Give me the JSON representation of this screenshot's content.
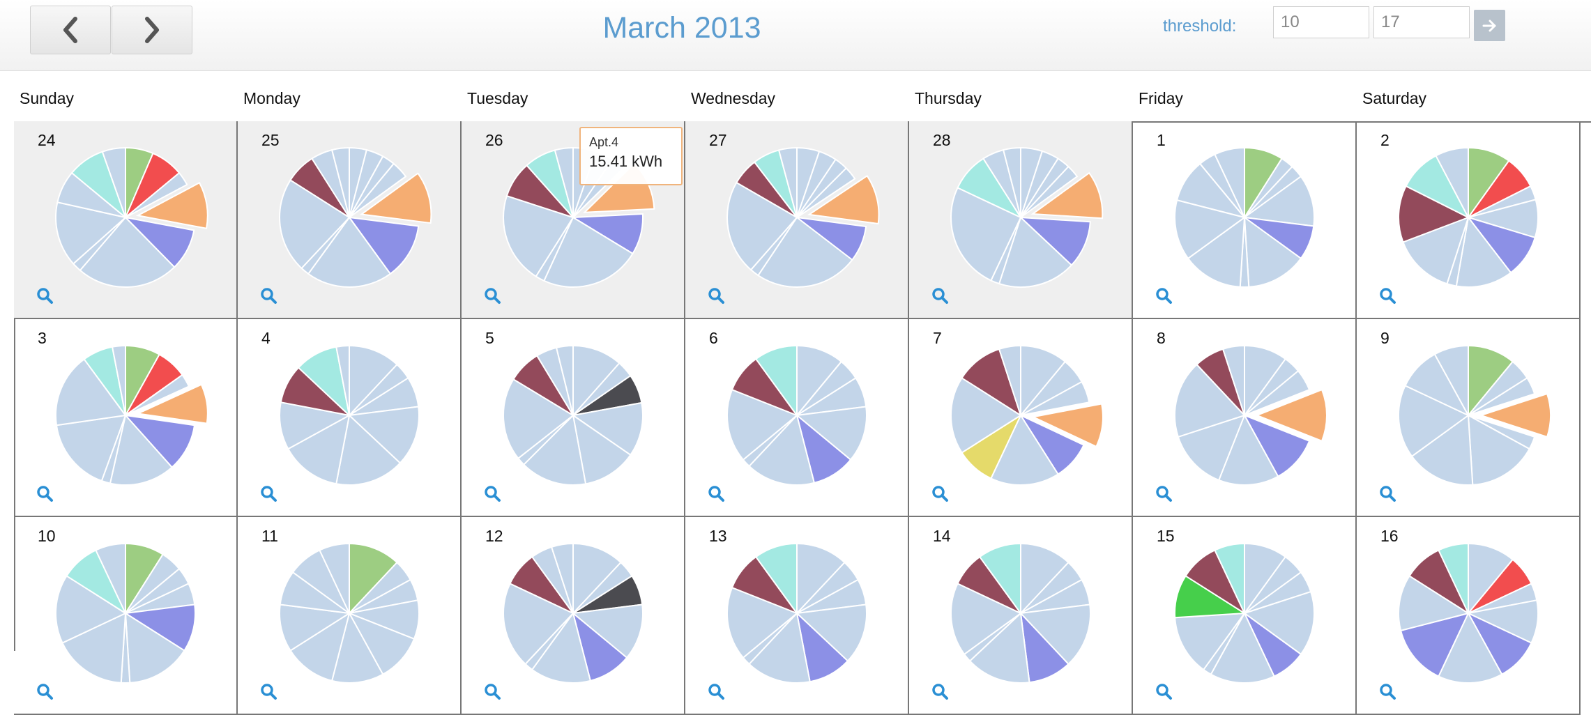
{
  "header": {
    "title": "March 2013",
    "prev_icon": "chevron-left-icon",
    "next_icon": "chevron-right-icon",
    "threshold_label": "threshold:",
    "threshold_low": "10",
    "threshold_high": "17",
    "go_icon": "arrow-right-icon"
  },
  "weekdays": [
    "Sunday",
    "Monday",
    "Tuesday",
    "Wednesday",
    "Thursday",
    "Friday",
    "Saturday"
  ],
  "colors": {
    "default": "#c3d5e9",
    "apt_green": "#9dcd82",
    "apt_red": "#f24d4e",
    "apt_orange": "#f5ad72",
    "apt_purple": "#8c90e6",
    "apt_maroon": "#934a5b",
    "apt_teal": "#a3e9e2",
    "apt_dark": "#4b4b50",
    "apt_yellow": "#e5da6a",
    "apt_brightgreen": "#46cf4b",
    "accent_blue": "#5b9ccf",
    "tooltip_border": "#f0b47c"
  },
  "tooltip": {
    "name": "Apt.4",
    "value": "15.41 kWh"
  },
  "weeks": [
    [
      {
        "day": "24",
        "other": true,
        "slices": [
          {
            "v": 6,
            "c": "apt_green"
          },
          {
            "v": 7,
            "c": "apt_red"
          },
          {
            "v": 3
          },
          {
            "v": 10,
            "c": "apt_orange",
            "x": true
          },
          {
            "v": 9,
            "c": "apt_purple"
          },
          {
            "v": 22
          },
          {
            "v": 2
          },
          {
            "v": 14
          },
          {
            "v": 7
          },
          {
            "v": 8,
            "c": "apt_teal"
          },
          {
            "v": 5
          }
        ]
      },
      {
        "day": "25",
        "other": true,
        "slices": [
          {
            "v": 4
          },
          {
            "v": 4
          },
          {
            "v": 3
          },
          {
            "v": 4
          },
          {
            "v": 12,
            "c": "apt_orange",
            "x": true
          },
          {
            "v": 13,
            "c": "apt_purple"
          },
          {
            "v": 20
          },
          {
            "v": 2
          },
          {
            "v": 22
          },
          {
            "v": 7,
            "c": "apt_maroon"
          },
          {
            "v": 5
          },
          {
            "v": 4
          }
        ]
      },
      {
        "day": "26",
        "other": true,
        "slices": [
          {
            "v": 5
          },
          {
            "v": 4
          },
          {
            "v": 3
          },
          {
            "v": 11,
            "c": "apt_orange",
            "x": true
          },
          {
            "v": 9,
            "c": "apt_purple"
          },
          {
            "v": 22
          },
          {
            "v": 2
          },
          {
            "v": 20
          },
          {
            "v": 8,
            "c": "apt_maroon"
          },
          {
            "v": 7,
            "c": "apt_teal"
          },
          {
            "v": 4
          }
        ]
      },
      {
        "day": "27",
        "other": true,
        "slices": [
          {
            "v": 5
          },
          {
            "v": 4
          },
          {
            "v": 3
          },
          {
            "v": 3
          },
          {
            "v": 11,
            "c": "apt_orange",
            "x": true
          },
          {
            "v": 8,
            "c": "apt_purple"
          },
          {
            "v": 23
          },
          {
            "v": 2
          },
          {
            "v": 21
          },
          {
            "v": 6,
            "c": "apt_maroon"
          },
          {
            "v": 6,
            "c": "apt_teal"
          },
          {
            "v": 4
          }
        ]
      },
      {
        "day": "28",
        "other": true,
        "slices": [
          {
            "v": 5
          },
          {
            "v": 4
          },
          {
            "v": 3
          },
          {
            "v": 3
          },
          {
            "v": 11,
            "c": "apt_orange",
            "x": true
          },
          {
            "v": 11,
            "c": "apt_purple"
          },
          {
            "v": 18
          },
          {
            "v": 2
          },
          {
            "v": 25
          },
          {
            "v": 9,
            "c": "apt_teal"
          },
          {
            "v": 5
          },
          {
            "v": 4
          }
        ]
      },
      {
        "day": "1",
        "other": false,
        "slices": [
          {
            "v": 9,
            "c": "apt_green"
          },
          {
            "v": 3
          },
          {
            "v": 3
          },
          {
            "v": 12
          },
          {
            "v": 8,
            "c": "apt_purple"
          },
          {
            "v": 14
          },
          {
            "v": 2
          },
          {
            "v": 14
          },
          {
            "v": 14
          },
          {
            "v": 10
          },
          {
            "v": 4
          },
          {
            "v": 7
          }
        ]
      },
      {
        "day": "2",
        "other": false,
        "slices": [
          {
            "v": 9,
            "c": "apt_green"
          },
          {
            "v": 7,
            "c": "apt_red"
          },
          {
            "v": 3
          },
          {
            "v": 8
          },
          {
            "v": 9,
            "c": "apt_purple"
          },
          {
            "v": 12
          },
          {
            "v": 2
          },
          {
            "v": 13
          },
          {
            "v": 12,
            "c": "apt_maroon"
          },
          {
            "v": 9,
            "c": "apt_teal"
          },
          {
            "v": 7
          }
        ]
      }
    ],
    [
      {
        "day": "3",
        "other": false,
        "slices": [
          {
            "v": 8,
            "c": "apt_green"
          },
          {
            "v": 7,
            "c": "apt_red"
          },
          {
            "v": 3
          },
          {
            "v": 9,
            "c": "apt_orange",
            "x": true
          },
          {
            "v": 11,
            "c": "apt_purple"
          },
          {
            "v": 15
          },
          {
            "v": 2
          },
          {
            "v": 17
          },
          {
            "v": 17
          },
          {
            "v": 7,
            "c": "apt_teal"
          },
          {
            "v": 3
          }
        ]
      },
      {
        "day": "4",
        "other": false,
        "slices": [
          {
            "v": 12
          },
          {
            "v": 4
          },
          {
            "v": 7
          },
          {
            "v": 14
          },
          {
            "v": 16
          },
          {
            "v": 14
          },
          {
            "v": 11
          },
          {
            "v": 9,
            "c": "apt_maroon"
          },
          {
            "v": 10,
            "c": "apt_teal"
          },
          {
            "v": 3
          }
        ]
      },
      {
        "day": "5",
        "other": false,
        "slices": [
          {
            "v": 12
          },
          {
            "v": 4
          },
          {
            "v": 7,
            "c": "apt_dark"
          },
          {
            "v": 13
          },
          {
            "v": 13
          },
          {
            "v": 16
          },
          {
            "v": 2
          },
          {
            "v": 20
          },
          {
            "v": 8,
            "c": "apt_maroon"
          },
          {
            "v": 5
          },
          {
            "v": 4
          }
        ]
      },
      {
        "day": "6",
        "other": false,
        "slices": [
          {
            "v": 11
          },
          {
            "v": 5
          },
          {
            "v": 7
          },
          {
            "v": 13
          },
          {
            "v": 10,
            "c": "apt_purple"
          },
          {
            "v": 16
          },
          {
            "v": 2
          },
          {
            "v": 17
          },
          {
            "v": 9,
            "c": "apt_maroon"
          },
          {
            "v": 10,
            "c": "apt_teal"
          }
        ]
      },
      {
        "day": "7",
        "other": false,
        "slices": [
          {
            "v": 11
          },
          {
            "v": 6
          },
          {
            "v": 5
          },
          {
            "v": 10,
            "c": "apt_orange",
            "x": true
          },
          {
            "v": 9,
            "c": "apt_purple"
          },
          {
            "v": 16
          },
          {
            "v": 9,
            "c": "apt_yellow"
          },
          {
            "v": 18
          },
          {
            "v": 11,
            "c": "apt_maroon"
          },
          {
            "v": 5
          }
        ]
      },
      {
        "day": "8",
        "other": false,
        "slices": [
          {
            "v": 10
          },
          {
            "v": 4
          },
          {
            "v": 5
          },
          {
            "v": 12,
            "c": "apt_orange",
            "x": true
          },
          {
            "v": 11,
            "c": "apt_purple"
          },
          {
            "v": 14
          },
          {
            "v": 14
          },
          {
            "v": 18
          },
          {
            "v": 7,
            "c": "apt_maroon"
          },
          {
            "v": 5
          }
        ]
      },
      {
        "day": "9",
        "other": false,
        "slices": [
          {
            "v": 11,
            "c": "apt_green"
          },
          {
            "v": 5
          },
          {
            "v": 4
          },
          {
            "v": 10,
            "c": "apt_orange",
            "x": true
          },
          {
            "v": 3
          },
          {
            "v": 16
          },
          {
            "v": 16
          },
          {
            "v": 17
          },
          {
            "v": 10
          },
          {
            "v": 8
          }
        ]
      }
    ],
    [
      {
        "day": "10",
        "other": false,
        "slices": [
          {
            "v": 9,
            "c": "apt_green"
          },
          {
            "v": 5
          },
          {
            "v": 4
          },
          {
            "v": 5
          },
          {
            "v": 11,
            "c": "apt_purple"
          },
          {
            "v": 15
          },
          {
            "v": 2
          },
          {
            "v": 17
          },
          {
            "v": 16
          },
          {
            "v": 9,
            "c": "apt_teal"
          },
          {
            "v": 7
          }
        ]
      },
      {
        "day": "11",
        "other": false,
        "slices": [
          {
            "v": 12,
            "c": "apt_green"
          },
          {
            "v": 5
          },
          {
            "v": 5
          },
          {
            "v": 9
          },
          {
            "v": 11
          },
          {
            "v": 12
          },
          {
            "v": 12
          },
          {
            "v": 11
          },
          {
            "v": 8
          },
          {
            "v": 8
          },
          {
            "v": 7
          }
        ]
      },
      {
        "day": "12",
        "other": false,
        "slices": [
          {
            "v": 12
          },
          {
            "v": 4
          },
          {
            "v": 7,
            "c": "apt_dark"
          },
          {
            "v": 13
          },
          {
            "v": 10,
            "c": "apt_purple"
          },
          {
            "v": 14
          },
          {
            "v": 2
          },
          {
            "v": 20
          },
          {
            "v": 8,
            "c": "apt_maroon"
          },
          {
            "v": 5
          },
          {
            "v": 5
          }
        ]
      },
      {
        "day": "13",
        "other": false,
        "slices": [
          {
            "v": 12
          },
          {
            "v": 5
          },
          {
            "v": 6
          },
          {
            "v": 14
          },
          {
            "v": 10,
            "c": "apt_purple"
          },
          {
            "v": 15
          },
          {
            "v": 2
          },
          {
            "v": 17
          },
          {
            "v": 9,
            "c": "apt_maroon"
          },
          {
            "v": 10,
            "c": "apt_teal"
          }
        ]
      },
      {
        "day": "14",
        "other": false,
        "slices": [
          {
            "v": 12
          },
          {
            "v": 5
          },
          {
            "v": 6
          },
          {
            "v": 15
          },
          {
            "v": 10,
            "c": "apt_purple"
          },
          {
            "v": 15
          },
          {
            "v": 2
          },
          {
            "v": 17
          },
          {
            "v": 8,
            "c": "apt_maroon"
          },
          {
            "v": 10,
            "c": "apt_teal"
          }
        ]
      },
      {
        "day": "15",
        "other": false,
        "slices": [
          {
            "v": 10
          },
          {
            "v": 5
          },
          {
            "v": 5
          },
          {
            "v": 15
          },
          {
            "v": 8,
            "c": "apt_purple"
          },
          {
            "v": 15
          },
          {
            "v": 2
          },
          {
            "v": 14
          },
          {
            "v": 10,
            "c": "apt_brightgreen"
          },
          {
            "v": 9,
            "c": "apt_maroon"
          },
          {
            "v": 7,
            "c": "apt_teal"
          }
        ]
      },
      {
        "day": "16",
        "other": false,
        "slices": [
          {
            "v": 11
          },
          {
            "v": 7,
            "c": "apt_red"
          },
          {
            "v": 4
          },
          {
            "v": 10
          },
          {
            "v": 10,
            "c": "apt_purple"
          },
          {
            "v": 15
          },
          {
            "v": 14,
            "c": "apt_purple"
          },
          {
            "v": 13
          },
          {
            "v": 9,
            "c": "apt_maroon"
          },
          {
            "v": 7,
            "c": "apt_teal"
          }
        ]
      }
    ]
  ]
}
